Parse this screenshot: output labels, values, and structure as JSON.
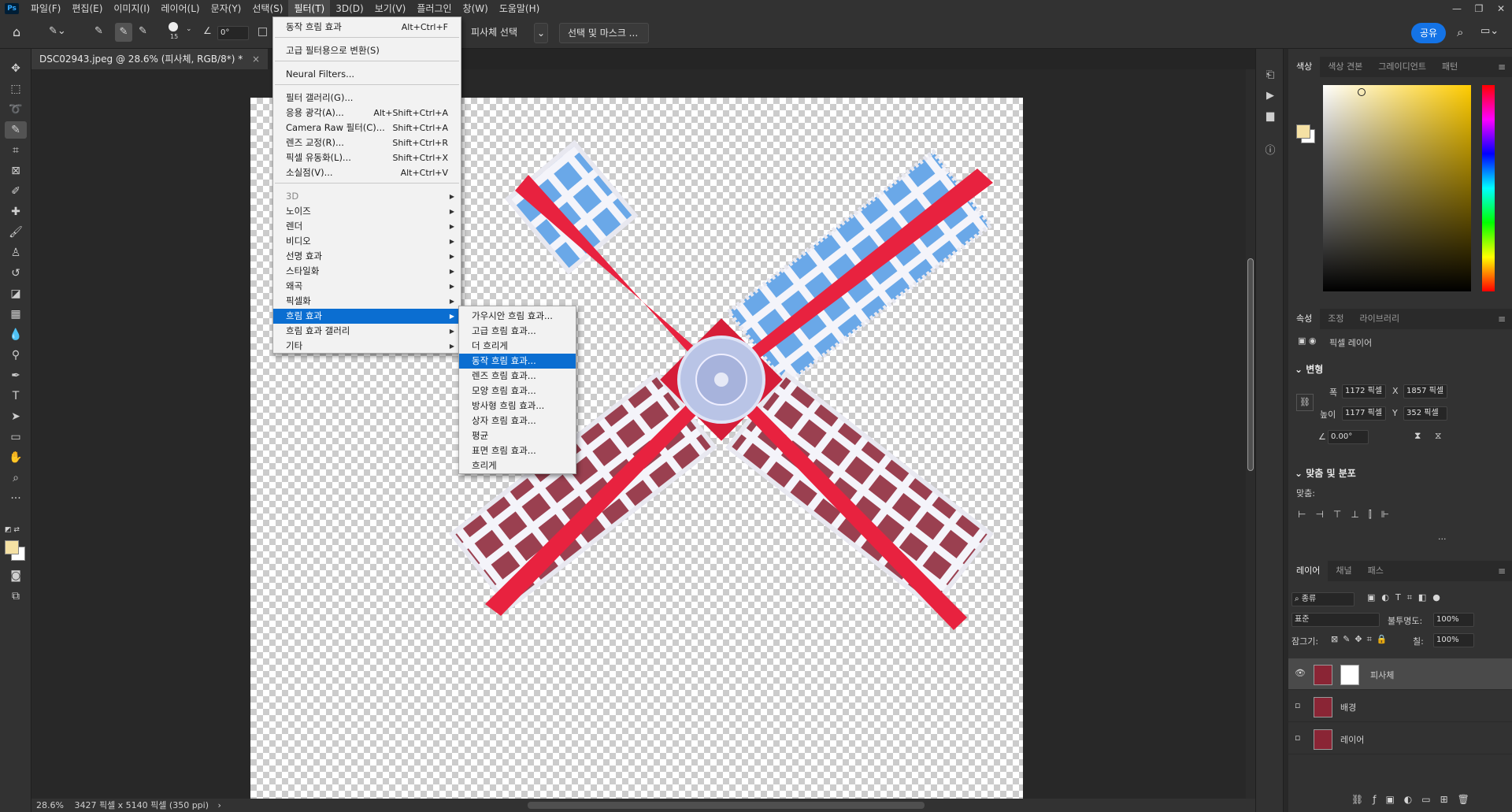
{
  "app": {
    "logo": "Ps"
  },
  "menubar": [
    "파일(F)",
    "편집(E)",
    "이미지(I)",
    "레이어(L)",
    "문자(Y)",
    "선택(S)",
    "필터(T)",
    "3D(D)",
    "보기(V)",
    "플러그인",
    "창(W)",
    "도움말(H)"
  ],
  "window_controls": [
    "—",
    "❐",
    "✕"
  ],
  "options": {
    "brush_size": "15",
    "angle": "0°",
    "select_subject": "피사체 선택",
    "select_mask": "선택 및 마스크 ...",
    "share": "공유"
  },
  "document_tab": "DSC02943.jpeg @ 28.6% (피사체, RGB/8*) *",
  "status": {
    "zoom": "28.6%",
    "info": "3427 픽셀 x 5140 픽셀 (350 ppi)"
  },
  "filter_menu": [
    {
      "label": "동작 흐림 효과",
      "shortcut": "Alt+Ctrl+F"
    },
    {
      "sep": true
    },
    {
      "label": "고급 필터용으로 변환(S)",
      "shortcut": ""
    },
    {
      "sep": true
    },
    {
      "label": "Neural Filters...",
      "shortcut": ""
    },
    {
      "sep": true
    },
    {
      "label": "필터 갤러리(G)...",
      "shortcut": ""
    },
    {
      "label": "응용 광각(A)...",
      "shortcut": "Alt+Shift+Ctrl+A"
    },
    {
      "label": "Camera Raw 필터(C)...",
      "shortcut": "Shift+Ctrl+A"
    },
    {
      "label": "렌즈 교정(R)...",
      "shortcut": "Shift+Ctrl+R"
    },
    {
      "label": "픽셀 유동화(L)...",
      "shortcut": "Shift+Ctrl+X"
    },
    {
      "label": "소실점(V)...",
      "shortcut": "Alt+Ctrl+V"
    },
    {
      "sep": true
    },
    {
      "label": "3D",
      "submenu": true,
      "disabled": true
    },
    {
      "label": "노이즈",
      "submenu": true
    },
    {
      "label": "렌더",
      "submenu": true
    },
    {
      "label": "비디오",
      "submenu": true
    },
    {
      "label": "선명 효과",
      "submenu": true
    },
    {
      "label": "스타일화",
      "submenu": true
    },
    {
      "label": "왜곡",
      "submenu": true
    },
    {
      "label": "픽셀화",
      "submenu": true
    },
    {
      "label": "흐림 효과",
      "submenu": true,
      "highlight": true
    },
    {
      "label": "흐림 효과 갤러리",
      "submenu": true
    },
    {
      "label": "기타",
      "submenu": true
    }
  ],
  "blur_submenu": [
    {
      "label": "가우시안 흐림 효과..."
    },
    {
      "label": "고급 흐림 효과..."
    },
    {
      "label": "더 흐리게"
    },
    {
      "label": "동작 흐림 효과...",
      "highlight": true
    },
    {
      "label": "렌즈 흐림 효과..."
    },
    {
      "label": "모양 흐림 효과..."
    },
    {
      "label": "방사형 흐림 효과..."
    },
    {
      "label": "상자 흐림 효과..."
    },
    {
      "label": "평균"
    },
    {
      "label": "표면 흐림 효과..."
    },
    {
      "label": "흐리게"
    }
  ],
  "color_panel": {
    "tabs": [
      "색상",
      "색상 견본",
      "그레이디언트",
      "패턴"
    ],
    "fg": "#f5e1a4",
    "bg": "#ffffff"
  },
  "properties": {
    "tabs": [
      "속성",
      "조정",
      "라이브러리"
    ],
    "layer_type": "픽셀 레이어",
    "transform_title": "변형",
    "w_label": "폭",
    "w": "1172 픽셀",
    "h_label": "높이",
    "h": "1177 픽셀",
    "x_label": "X",
    "x": "1857 픽셀",
    "y_label": "Y",
    "y": "352 픽셀",
    "angle": "0.00°",
    "align_title": "맞춤 및 분포",
    "align_label": "맞춤:",
    "more": "···"
  },
  "layers_panel": {
    "tabs": [
      "레이어",
      "채널",
      "패스"
    ],
    "filter_kind": "종류",
    "blend": "표준",
    "opacity_label": "불투명도:",
    "opacity": "100%",
    "lock_label": "잠그기:",
    "fill_label": "칠:",
    "fill": "100%",
    "layers": [
      {
        "name": "피사체",
        "visible": true,
        "selected": true
      },
      {
        "name": "배경",
        "visible": false,
        "selected": false
      },
      {
        "name": "레이어",
        "visible": false,
        "selected": false
      }
    ]
  }
}
